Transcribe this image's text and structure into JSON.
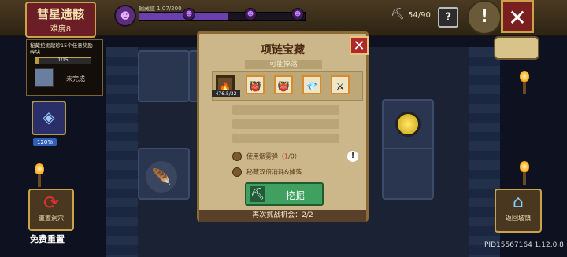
{
  "header": {
    "stage_name": "彗星遗骸",
    "difficulty": "难度8",
    "progress_label": "掘藏值 1,07/200",
    "progress_value": 0.54,
    "stamina": "54/90",
    "help_label": "?",
    "alert_label": "!",
    "close_label": "✕"
  },
  "quest": {
    "description": "秘藏挖掘献珍15个任意奖励 碎块",
    "progress_text": "1/15",
    "progress_value": 0.07,
    "status": "未完成"
  },
  "left": {
    "gem_percent": "120%",
    "reset_label": "重置洞穴",
    "free_reset": "免费重置"
  },
  "right": {
    "home_label": "返回城镇"
  },
  "modal": {
    "title": "项链宝藏",
    "drops_label": "可能掉落",
    "first_drop_count": "476.5/32",
    "drops": [
      "🔥",
      "👹",
      "👹",
      "💎",
      "⚔"
    ],
    "option1_prefix": "使用烟雾弹（",
    "option1_count": "1",
    "option1_suffix": "/0）",
    "option2": "秘藏双倍消耗&掉落",
    "info_label": "!",
    "dig_label": "挖掘",
    "retry": "再次挑战机会：2/2",
    "close_label": "✕"
  },
  "footer": {
    "pid": "PID15567164 1.12.0.8"
  },
  "colors": {
    "accent_gold": "#c9a24a",
    "dig_green": "#3fa060",
    "close_red": "#b02828"
  }
}
